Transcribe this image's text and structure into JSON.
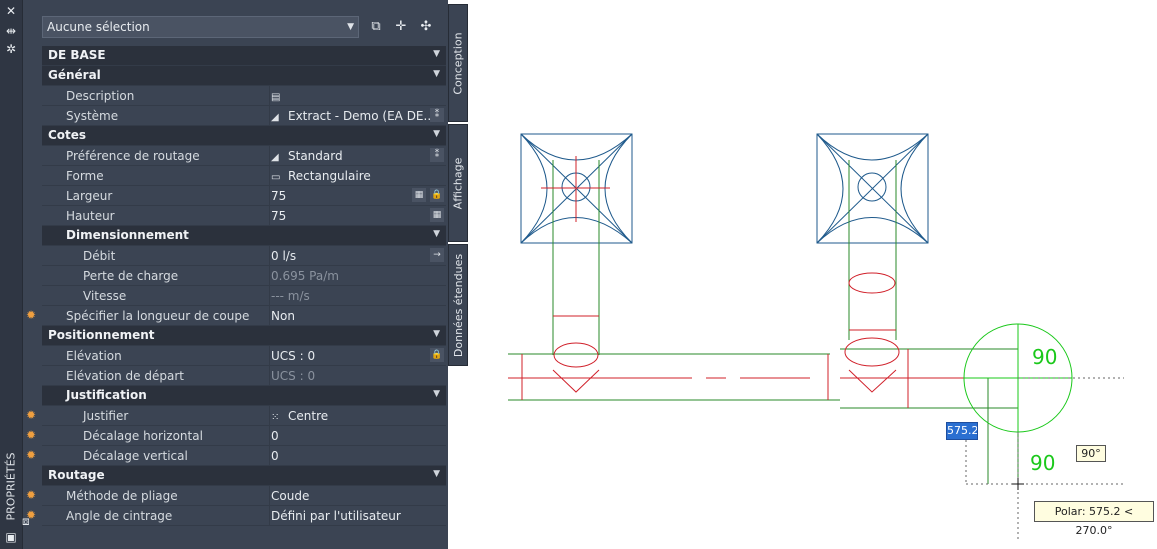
{
  "palette": {
    "vertical_title": "PROPRIÉTÉS",
    "selector": {
      "value": "Aucune sélection"
    },
    "tabs": [
      "Conception",
      "Affichage",
      "Données étendues"
    ],
    "sections": [
      {
        "type": "cat",
        "label": "DE BASE"
      },
      {
        "type": "cat",
        "label": "Général"
      },
      {
        "type": "prop",
        "label": "Description",
        "value": "",
        "icon": "▤"
      },
      {
        "type": "prop",
        "label": "Système",
        "value": "Extract - Demo (EA DE...",
        "icon": "◢",
        "btn": "⁑"
      },
      {
        "type": "cat",
        "label": "Cotes"
      },
      {
        "type": "prop",
        "label": "Préférence de routage",
        "value": "Standard",
        "icon": "◢",
        "btn": "⁑"
      },
      {
        "type": "prop",
        "label": "Forme",
        "value": "Rectangulaire",
        "icon": "▭"
      },
      {
        "type": "prop",
        "label": "Largeur",
        "value": "75",
        "btn": "▦",
        "btn2": "🔒"
      },
      {
        "type": "prop",
        "label": "Hauteur",
        "value": "75",
        "btn": "▦"
      },
      {
        "type": "subcat",
        "label": "Dimensionnement"
      },
      {
        "type": "prop2",
        "label": "Débit",
        "value": "0 l/s",
        "btn": "→"
      },
      {
        "type": "prop2",
        "label": "Perte de charge",
        "value": "0.695 Pa/m",
        "grey": true
      },
      {
        "type": "prop2",
        "label": "Vitesse",
        "value": "--- m/s",
        "grey": true
      },
      {
        "type": "prop",
        "label": "Spécifier la longueur de coupe",
        "value": "Non",
        "star": true
      },
      {
        "type": "cat",
        "label": "Positionnement"
      },
      {
        "type": "prop",
        "label": "Elévation",
        "value": "UCS : 0",
        "btn": "🔒"
      },
      {
        "type": "prop",
        "label": "Elévation de départ",
        "value": "UCS : 0",
        "grey": true
      },
      {
        "type": "subcat",
        "label": "Justification"
      },
      {
        "type": "prop2",
        "label": "Justifier",
        "value": "Centre",
        "icon": "⁙",
        "star": true
      },
      {
        "type": "prop2",
        "label": "Décalage horizontal",
        "value": "0",
        "star": true
      },
      {
        "type": "prop2",
        "label": "Décalage vertical",
        "value": "0",
        "star": true
      },
      {
        "type": "cat",
        "label": "Routage"
      },
      {
        "type": "prop",
        "label": "Méthode de pliage",
        "value": "Coude",
        "star": true
      },
      {
        "type": "prop",
        "label": "Angle de cintrage",
        "value": "Défini par l'utilisateur",
        "star": true
      }
    ]
  },
  "drawing": {
    "dimension_input": "575.2",
    "angle_label": "90°",
    "polar_tooltip": "Polar: 575.2 < 270.0°",
    "compass_labels": [
      "90",
      "90"
    ]
  }
}
